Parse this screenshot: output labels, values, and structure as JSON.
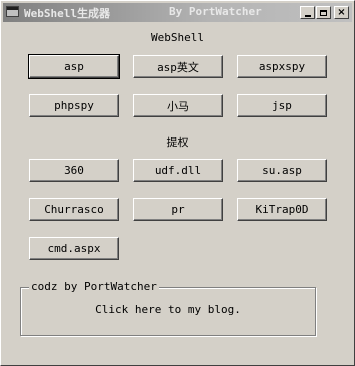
{
  "window": {
    "title": "WebShell生成器",
    "credit": "By PortWatcher",
    "minimize_label": "",
    "maximize_label": "",
    "close_label": "×"
  },
  "webshell": {
    "heading": "WebShell",
    "buttons": [
      "asp",
      "asp英文",
      "aspxspy",
      "phpspy",
      "小马",
      "jsp"
    ]
  },
  "privilege": {
    "heading": "提权",
    "buttons": [
      "360",
      "udf.dll",
      "su.asp",
      "Churrasco",
      "pr",
      "KiTrap0D",
      "cmd.aspx"
    ]
  },
  "footer": {
    "group_title": "codz by PortWatcher",
    "blog_link": "Click here to my blog."
  }
}
